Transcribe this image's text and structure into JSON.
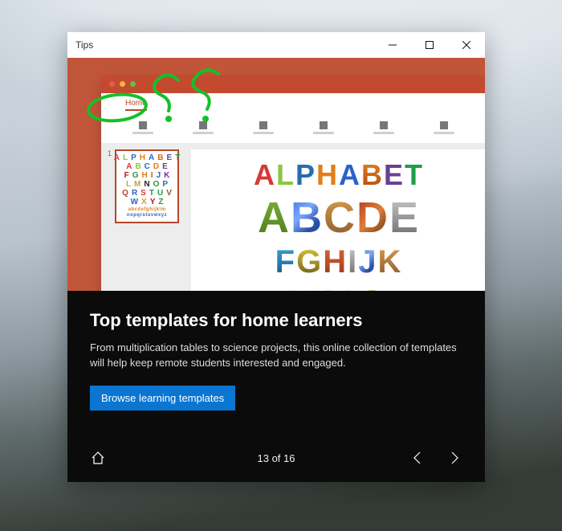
{
  "window": {
    "title": "Tips"
  },
  "hero": {
    "app_tab": "Home",
    "traffic_lights": [
      "red",
      "yellow",
      "green"
    ],
    "thumbnail_number": "1",
    "alphabet_title_letters": [
      "A",
      "L",
      "P",
      "H",
      "A",
      "B",
      "E",
      "T"
    ],
    "slide_rows": {
      "r1": [
        "A",
        "B",
        "C",
        "D",
        "E"
      ],
      "r2": [
        "F",
        "G",
        "H",
        "I",
        "J",
        "K"
      ],
      "r3": [
        "L",
        "M",
        "N",
        "O",
        "P"
      ]
    },
    "mini_rows": [
      [
        "A",
        "L",
        "P",
        "H",
        "A",
        "B",
        "E",
        "T"
      ],
      [
        "A",
        "B",
        "C",
        "D",
        "E"
      ],
      [
        "F",
        "G",
        "H",
        "I",
        "J",
        "K"
      ],
      [
        "L",
        "M",
        "N",
        "O",
        "P"
      ],
      [
        "Q",
        "R",
        "S",
        "T",
        "U",
        "V"
      ],
      [
        "W",
        "X",
        "Y",
        "Z"
      ]
    ],
    "mini_lowercase": "abcdefghijklm",
    "mini_lowercase2": "nopqrstuvwxyz"
  },
  "annotation": {
    "mark": "??"
  },
  "caption": {
    "title": "Top templates for home learners",
    "body": "From multiplication tables to science projects, this online collection of templates will help keep remote students interested and engaged.",
    "button": "Browse learning templates"
  },
  "nav": {
    "current": 13,
    "total": 16,
    "counter": "13 of 16"
  }
}
